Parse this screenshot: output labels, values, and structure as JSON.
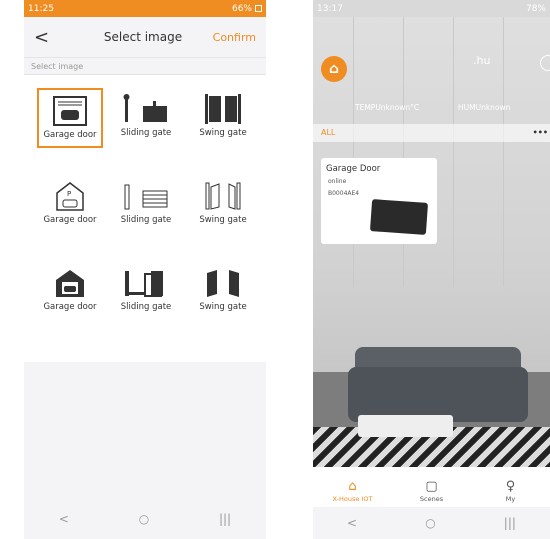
{
  "left": {
    "status": {
      "time": "11:25",
      "right": "66%"
    },
    "header": {
      "back": "<",
      "title": "Select image",
      "confirm": "Confirm"
    },
    "subheader": "Select image",
    "items": [
      {
        "label": "Garage door",
        "icon": "garage-door-icon"
      },
      {
        "label": "Sliding gate",
        "icon": "sliding-gate-icon"
      },
      {
        "label": "Swing gate",
        "icon": "swing-gate-icon"
      },
      {
        "label": "Garage door",
        "icon": "garage-parking-icon"
      },
      {
        "label": "Sliding gate",
        "icon": "sliding-gate-outline-icon"
      },
      {
        "label": "Swing gate",
        "icon": "swing-gate-outline-icon"
      },
      {
        "label": "Garage door",
        "icon": "garage-car-icon"
      },
      {
        "label": "Sliding gate",
        "icon": "sliding-gate-bold-icon"
      },
      {
        "label": "Swing gate",
        "icon": "swing-gate-bold-icon"
      }
    ],
    "selected_index": 0,
    "nav": {
      "back": "<",
      "home": "○",
      "recent": "|||"
    }
  },
  "right": {
    "status": {
      "time": "13:17",
      "right": "78%"
    },
    "logo": "⌂",
    "username": ".hu",
    "temp": "TEMPUnknown°C",
    "hum": "HUMUnknown",
    "filter_tab": "ALL",
    "more": "•••",
    "device": {
      "name": "Garage Door",
      "status": "online",
      "id": "B0004AE4"
    },
    "bottom_nav": [
      {
        "label": "X-House IOT",
        "glyph": "⌂"
      },
      {
        "label": "Scenes",
        "glyph": "▢"
      },
      {
        "label": "My",
        "glyph": "♀"
      }
    ],
    "nav": {
      "back": "<",
      "home": "○",
      "recent": "|||"
    }
  },
  "colors": {
    "accent": "#ef8d22",
    "text": "#333333"
  }
}
